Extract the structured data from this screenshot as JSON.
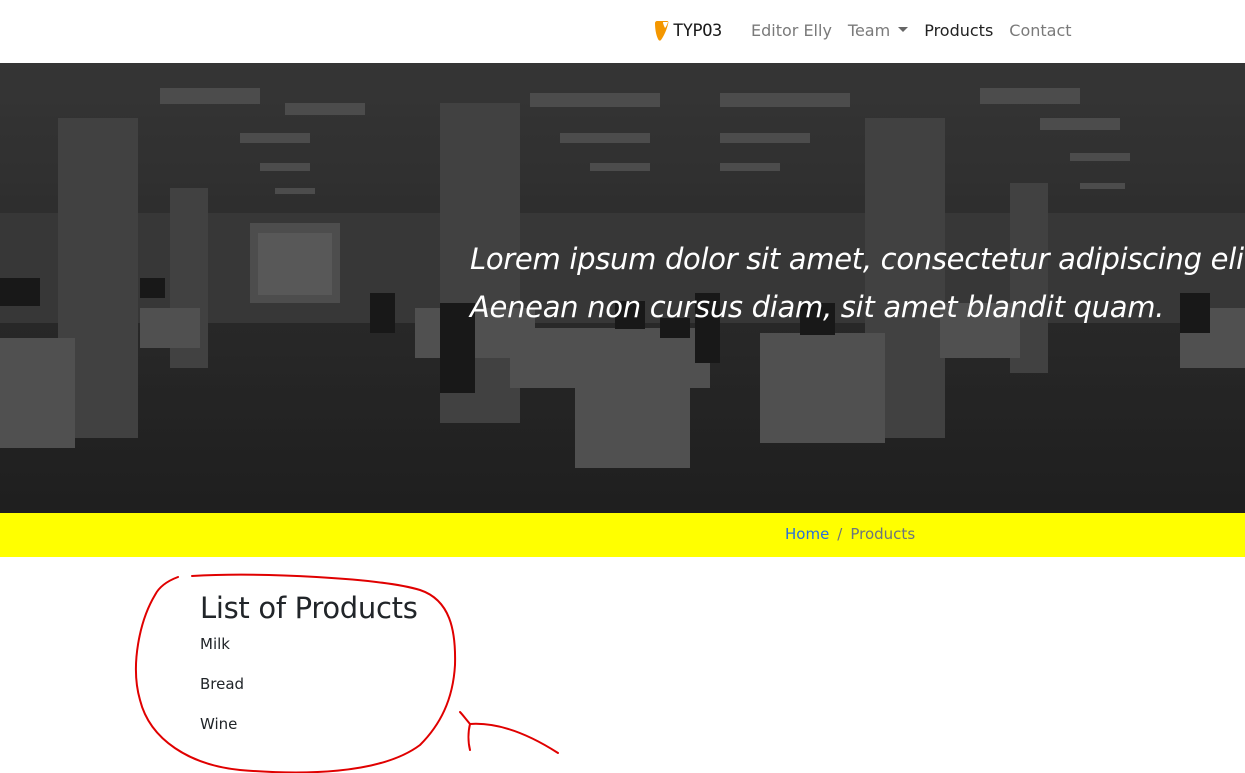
{
  "navbar": {
    "brand_text": "TYPO3",
    "items": [
      {
        "label": "Editor Elly",
        "active": false,
        "dropdown": false
      },
      {
        "label": "Team",
        "active": false,
        "dropdown": true
      },
      {
        "label": "Products",
        "active": true,
        "dropdown": false
      },
      {
        "label": "Contact",
        "active": false,
        "dropdown": false
      }
    ]
  },
  "hero": {
    "line1": "Lorem ipsum dolor sit amet, consectetur adipiscing elit.",
    "line2": "Aenean non cursus diam, sit amet blandit quam."
  },
  "breadcrumb": {
    "home": "Home",
    "separator": "/",
    "current": "Products"
  },
  "content": {
    "title": "List of Products",
    "items": [
      "Milk",
      "Bread",
      "Wine"
    ]
  },
  "colors": {
    "breadcrumb_bg": "#ffff00",
    "brand_orange": "#f49700",
    "link_blue": "#2a6fdb",
    "annotation_red": "#e00000"
  }
}
